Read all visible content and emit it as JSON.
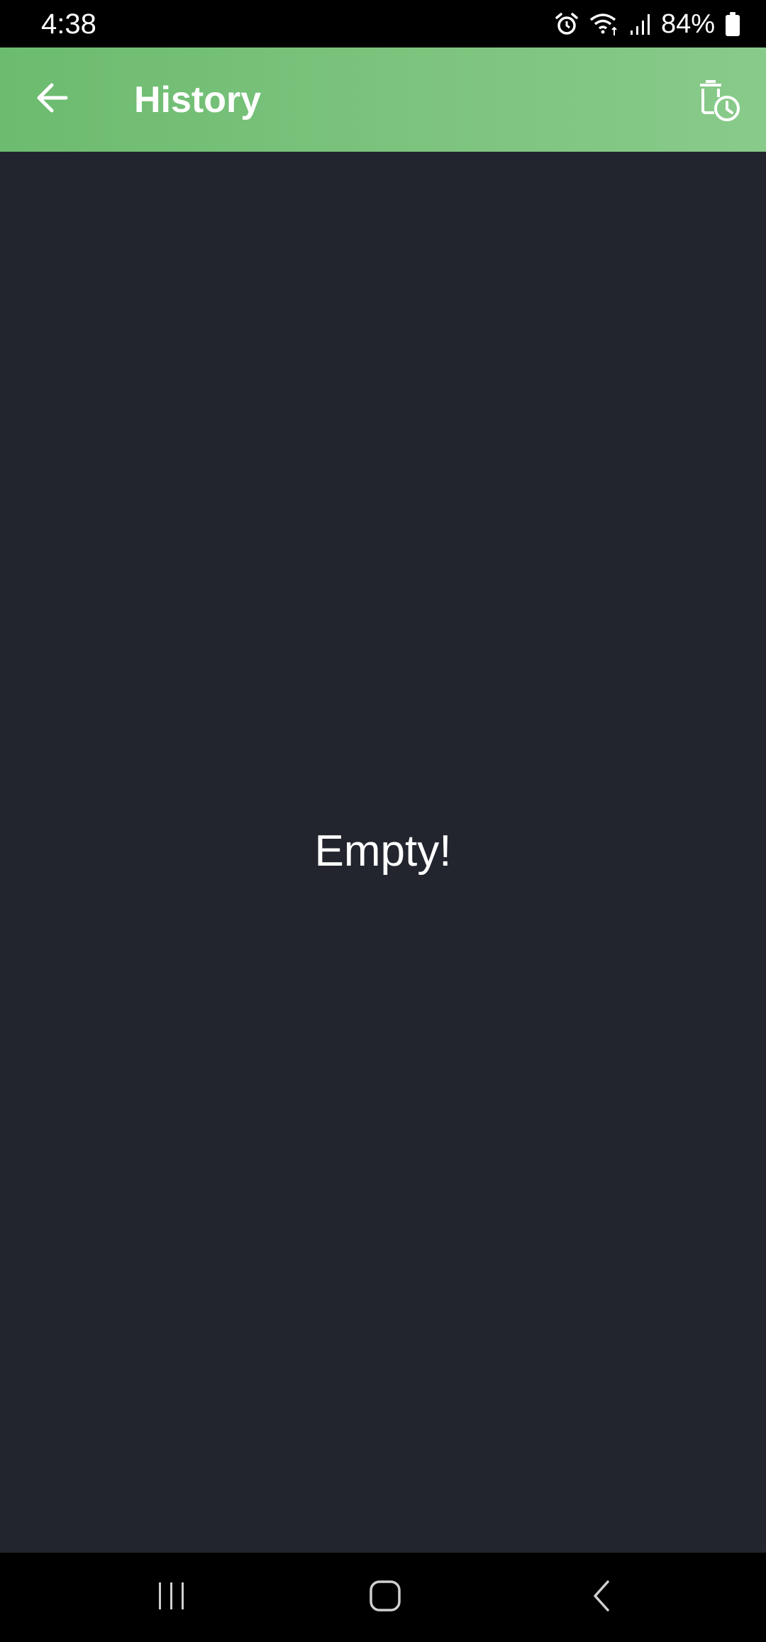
{
  "status_bar": {
    "time": "4:38",
    "battery_percent": "84%",
    "icons": [
      "alarm-icon",
      "wifi-icon",
      "signal-icon",
      "battery-icon"
    ]
  },
  "app_bar": {
    "title": "History",
    "back_icon": "arrow-left-icon",
    "action_icon": "delete-history-icon",
    "gradient_colors": [
      "#6cbb6f",
      "#88ca8a"
    ]
  },
  "content": {
    "empty_text": "Empty!",
    "background": "#23252e"
  },
  "nav_bar": {
    "buttons": [
      "recents-icon",
      "home-icon",
      "back-icon"
    ]
  }
}
